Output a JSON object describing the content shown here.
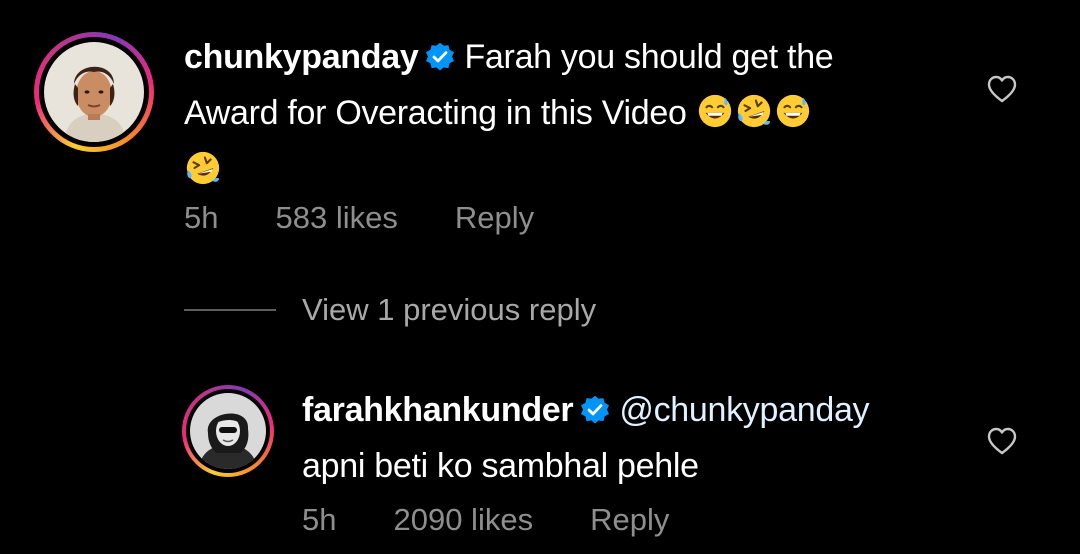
{
  "comments": [
    {
      "username": "chunkypanday",
      "text_lines": [
        "Farah you should get the",
        "Award for Overacting in this Video"
      ],
      "emoji_line1": [
        "grinning-sweat-emoji",
        "rolling-laughing-emoji",
        "grinning-sweat-emoji"
      ],
      "emoji_line2": [
        "rolling-laughing-emoji"
      ],
      "time": "5h",
      "likes": "583 likes",
      "reply": "Reply"
    },
    {
      "username": "farahkhankunder",
      "mention": "@chunkypanday",
      "text": "apni beti ko sambhal pehle",
      "time": "5h",
      "likes": "2090 likes",
      "reply": "Reply"
    }
  ],
  "view_replies": "View 1 previous reply",
  "colors": {
    "background": "#000000",
    "text": "#ffffff",
    "secondary": "#8e8e8e",
    "verified": "#0095f6",
    "mention": "#e0f1ff"
  }
}
